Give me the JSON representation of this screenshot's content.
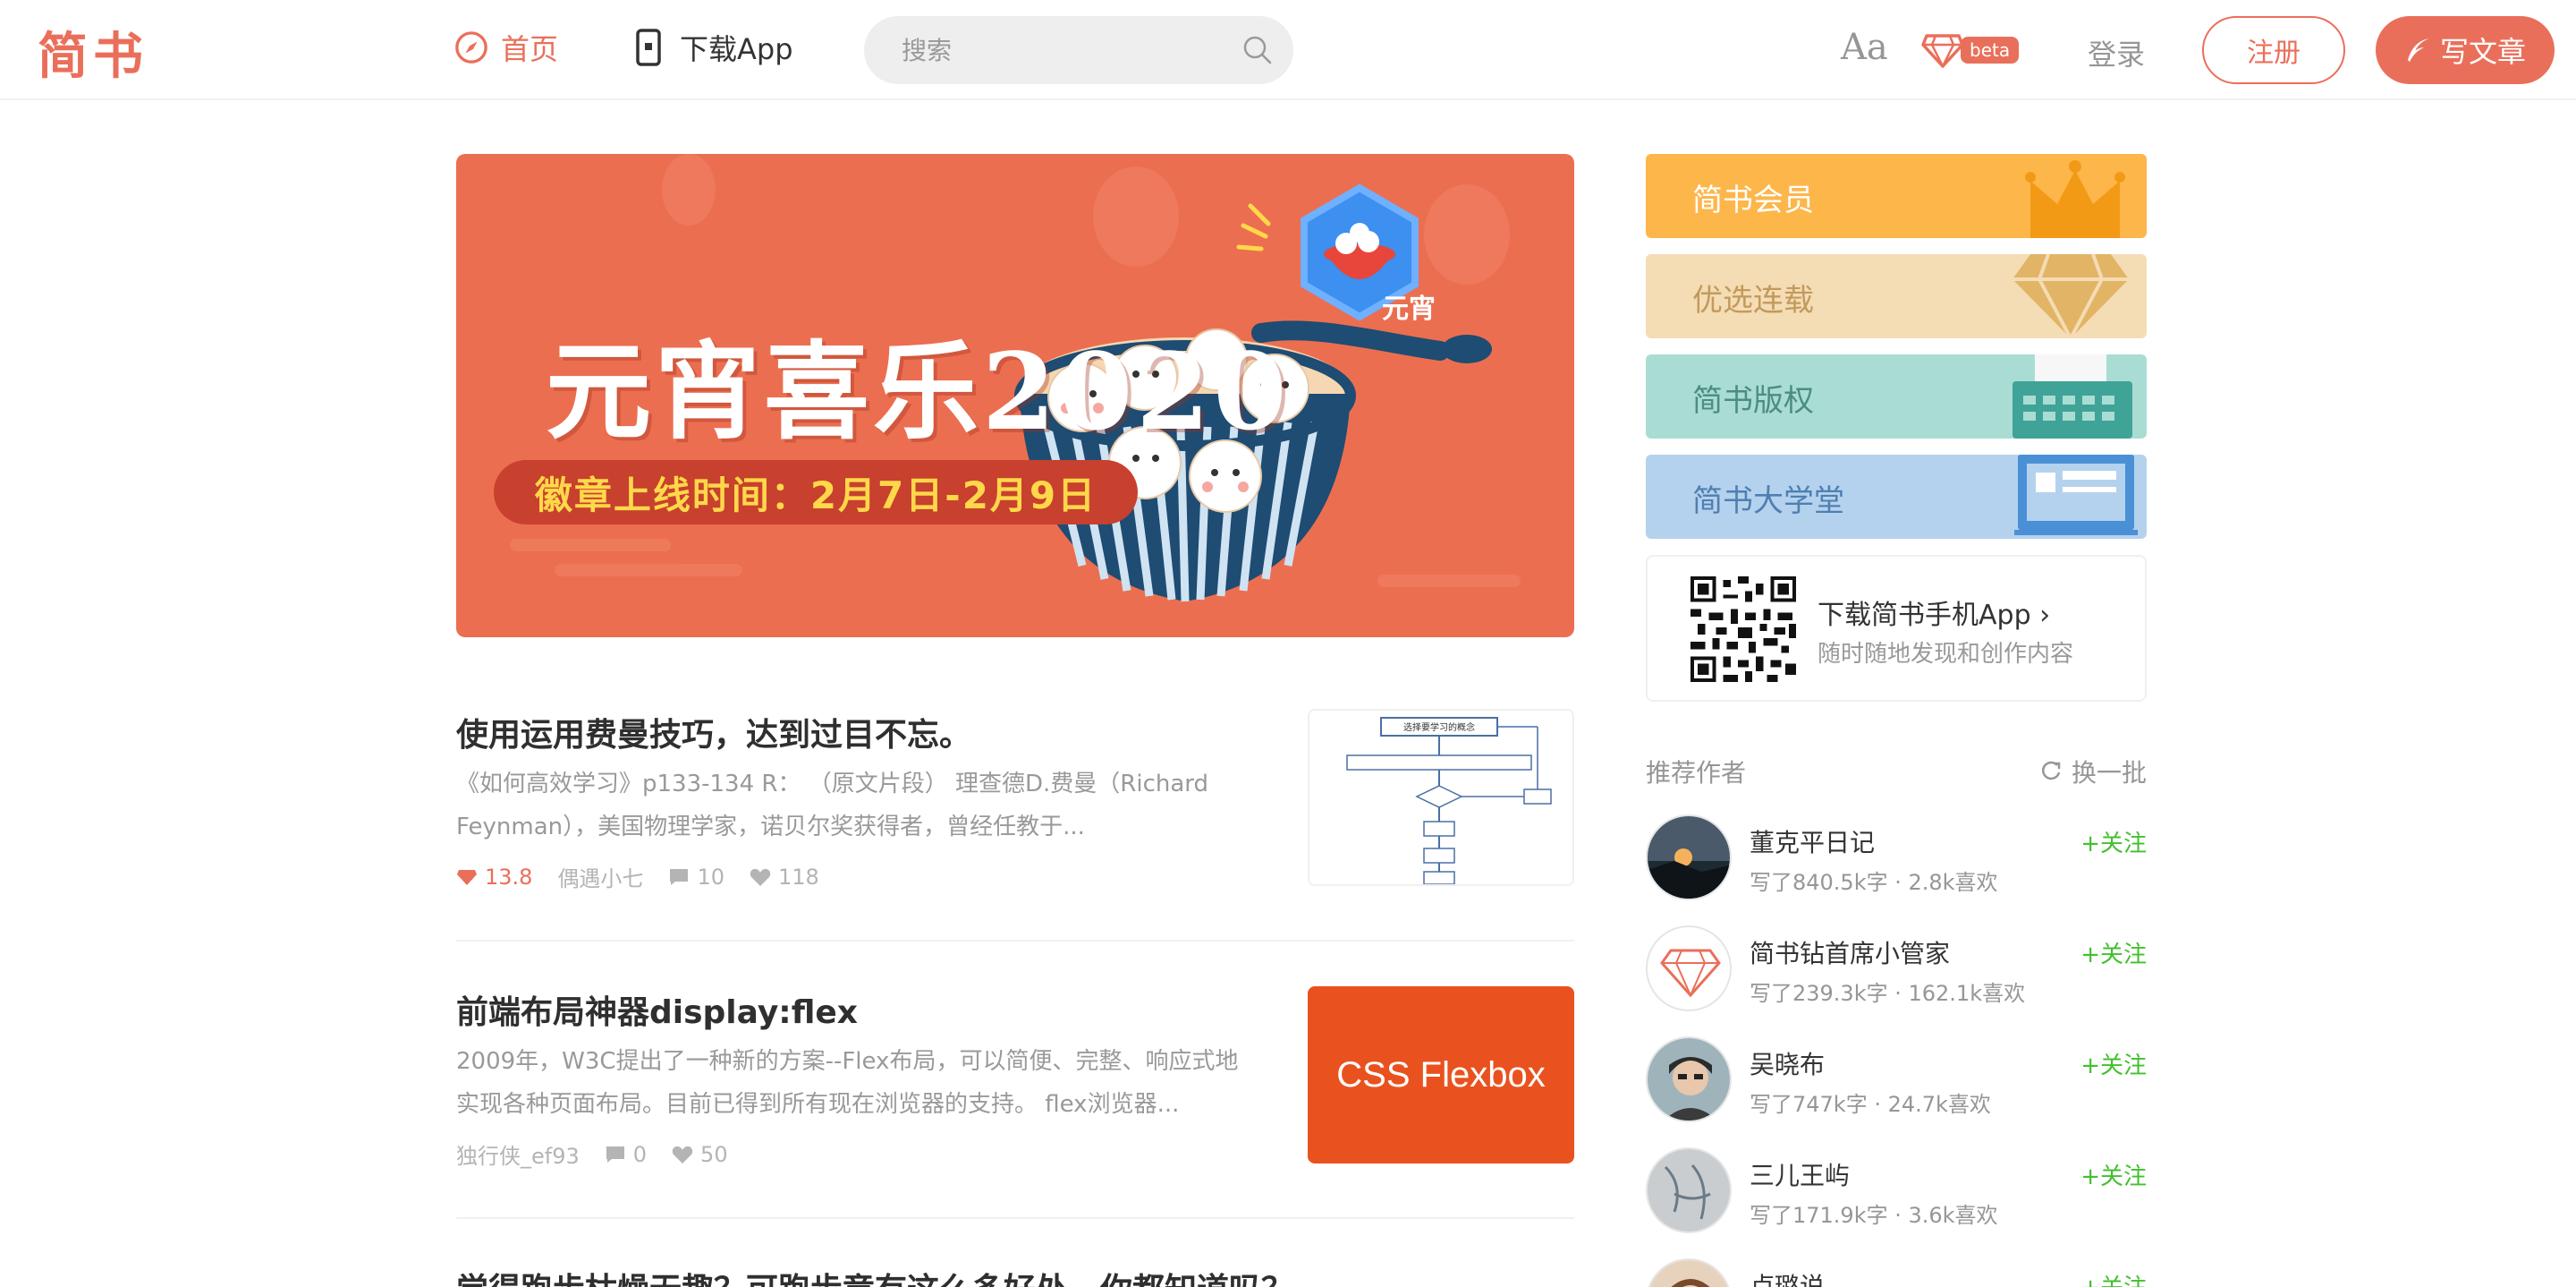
{
  "header": {
    "logo": "简书",
    "nav_home": "首页",
    "nav_app": "下载App",
    "search_placeholder": "搜索",
    "font_toggle": "Aa",
    "beta_tag": "beta",
    "login": "登录",
    "signup": "注册",
    "write": "写文章",
    "accent_color": "#ea6f5a"
  },
  "banner": {
    "title": "元宵喜乐2020",
    "subtitle": "徽章上线时间：2月7日-2月9日",
    "badge": "元宵",
    "background": "#ec6e50"
  },
  "articles": [
    {
      "title": "使用运用费曼技巧，达到过目不忘。",
      "abstract": "《如何高效学习》p133-134 R： （原文片段） 理查德D.费曼（Richard Feynman），美国物理学家，诺贝尔奖获得者，曾经任教于...",
      "diamond": "13.8",
      "author": "偶遇小七",
      "comments": "10",
      "likes": "118",
      "thumb_icon": "flowchart-thumbnail",
      "thumb_title": "选择要学习的概念"
    },
    {
      "title": "前端布局神器display:flex",
      "abstract": "2009年，W3C提出了一种新的方案--Flex布局，可以简便、完整、响应式地实现各种页面布局。目前已得到所有现在浏览器的支持。 flex浏览器...",
      "author": "独行侠_ef93",
      "comments": "0",
      "likes": "50",
      "thumb_text": "CSS Flexbox"
    },
    {
      "title": "觉得跑步枯燥无趣？可跑步竟有这么多好处，你都知道吗？"
    }
  ],
  "sidebar": {
    "banners": [
      {
        "label": "简书会员",
        "color": "#fdb64a",
        "icon": "crown-icon"
      },
      {
        "label": "优选连载",
        "color": "#f4dcb4",
        "text_color": "#c39a5c",
        "icon": "diamond-icon"
      },
      {
        "label": "简书版权",
        "color": "#a9ddd3",
        "text_color": "#4c8c82",
        "icon": "typewriter-icon"
      },
      {
        "label": "简书大学堂",
        "color": "#b4d2ee",
        "text_color": "#4f7fb0",
        "icon": "monitor-icon"
      }
    ],
    "app": {
      "title": "下载简书手机App",
      "subtitle": "随时随地发现和创作内容"
    },
    "recommend": {
      "title": "推荐作者",
      "refresh": "换一批",
      "follow_label": "+关注",
      "authors": [
        {
          "name": "董克平日记",
          "desc": "写了840.5k字 · 2.8k喜欢"
        },
        {
          "name": "简书钻首席小管家",
          "desc": "写了239.3k字 · 162.1k喜欢"
        },
        {
          "name": "吴晓布",
          "desc": "写了747k字 · 24.7k喜欢"
        },
        {
          "name": "三儿王屿",
          "desc": "写了171.9k字 · 3.6k喜欢"
        },
        {
          "name": "卢璐说"
        }
      ]
    }
  }
}
